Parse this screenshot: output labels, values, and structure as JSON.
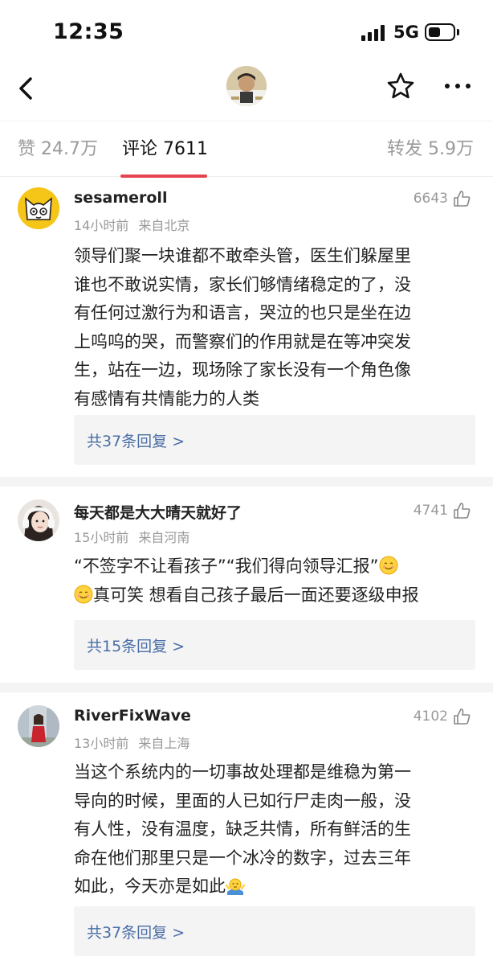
{
  "status_bar": {
    "time": "12:35",
    "network": "5G"
  },
  "nav": {
    "back_icon": "chevron-left-icon",
    "avatar_icon": "profile-avatar",
    "star_icon": "star-outline-icon",
    "more_icon": "more-horizontal-icon"
  },
  "tabs": {
    "likes": "赞 24.7万",
    "comments": "评论 7611",
    "reposts": "转发 5.9万",
    "accent": "#e5434d"
  },
  "comments": [
    {
      "user": "sesameroll",
      "time": "14小时前",
      "location": "来自北京",
      "likes": "6643",
      "lines": [
        "领导们聚一块谁都不敢牵头管，医生们躲屋里",
        "谁也不敢说实情，家长们够情绪稳定的了，没",
        "有任何过激行为和语言，哭泣的也只是坐在边",
        "上呜呜的哭，而警察们的作用就是在等冲突发",
        "生，站在一边，现场除了家长没有一个角色像",
        "有感情有共情能力的人类"
      ],
      "replies": "共37条回复 >"
    },
    {
      "user": "每天都是大大晴天就好了",
      "time": "15小时前",
      "location": "来自河南",
      "likes": "4741",
      "lines": [
        "“不签字不让看孩子”“我们得向领导汇报”",
        "真可笑 想看自己孩子最后一面还要逐级申报"
      ],
      "emoji": "smiling-face-emoji",
      "replies": "共15条回复 >"
    },
    {
      "user": "RiverFixWave",
      "time": "13小时前",
      "location": "来自上海",
      "likes": "4102",
      "lines": [
        "当这个系统内的一切事故处理都是维稳为第一",
        "导向的时候，里面的人已如行尸走肉一般，没",
        "有人性，没有温度，缺乏共情，所有鲜活的生",
        "命在他们那里只是一个冰冷的数字，过去三年",
        "如此，今天亦是如此"
      ],
      "emoji": "shrug-emoji",
      "replies": "共37条回复 >"
    }
  ]
}
